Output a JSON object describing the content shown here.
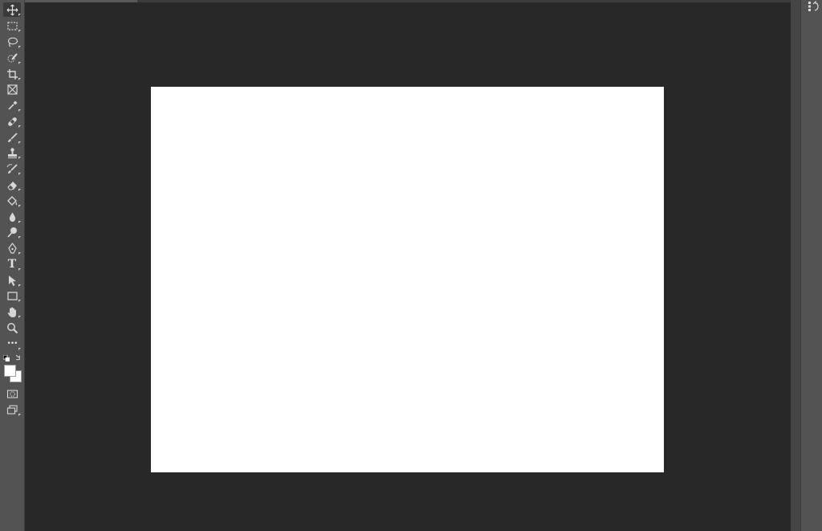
{
  "app": {
    "name": "image-editor"
  },
  "colors": {
    "workspace_bg": "#282828",
    "document_bg": "#ffffff",
    "ui_panel": "#535353",
    "foreground_swatch": "#ffffff",
    "background_swatch": "#ffffff"
  },
  "toolbar": {
    "tools": [
      {
        "name": "move-tool",
        "icon": "move-icon",
        "active": true
      },
      {
        "name": "marquee-tool",
        "icon": "rectangular-marquee-icon"
      },
      {
        "name": "lasso-tool",
        "icon": "lasso-icon"
      },
      {
        "name": "quick-selection-tool",
        "icon": "quick-selection-icon"
      },
      {
        "name": "crop-tool",
        "icon": "crop-icon"
      },
      {
        "name": "frame-tool",
        "icon": "frame-icon"
      },
      {
        "name": "eyedropper-tool",
        "icon": "eyedropper-icon"
      },
      {
        "name": "healing-brush-tool",
        "icon": "bandage-icon"
      },
      {
        "name": "brush-tool",
        "icon": "brush-icon"
      },
      {
        "name": "clone-stamp-tool",
        "icon": "stamp-icon"
      },
      {
        "name": "history-brush-tool",
        "icon": "history-brush-icon"
      },
      {
        "name": "eraser-tool",
        "icon": "eraser-icon"
      },
      {
        "name": "paint-bucket-tool",
        "icon": "paint-bucket-icon"
      },
      {
        "name": "blur-tool",
        "icon": "drop-icon"
      },
      {
        "name": "dodge-tool",
        "icon": "dodge-icon"
      },
      {
        "name": "pen-tool",
        "icon": "pen-icon"
      },
      {
        "name": "type-tool",
        "icon": "type-icon",
        "label": "T"
      },
      {
        "name": "path-selection-tool",
        "icon": "arrow-cursor-icon"
      },
      {
        "name": "rectangle-tool",
        "icon": "rectangle-icon"
      },
      {
        "name": "hand-tool",
        "icon": "hand-icon"
      },
      {
        "name": "zoom-tool",
        "icon": "magnifier-icon"
      },
      {
        "name": "edit-toolbar",
        "icon": "more-dots-icon",
        "label": "•••"
      }
    ]
  },
  "right_panel": {
    "icons": [
      "history-panel-icon"
    ]
  }
}
